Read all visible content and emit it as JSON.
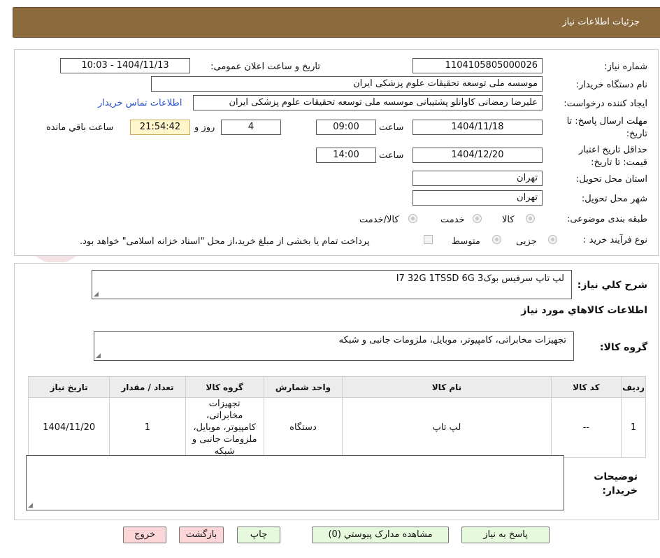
{
  "header": {
    "title": "جزئیات اطلاعات نیاز"
  },
  "form": {
    "need_number_label": "شماره نیاز:",
    "need_number": "1104105805000026",
    "announce_label": "تاریخ و ساعت اعلان عمومی:",
    "announce_value": "1404/11/13 - 10:03",
    "buyer_org_label": "نام دستگاه خریدار:",
    "buyer_org": "موسسه ملی توسعه تحقیقات علوم پزشکی ایران",
    "creator_label": "ایجاد کننده درخواست:",
    "creator": "علیرضا رمضانی کاوانلو پشتیبانی موسسه ملی توسعه تحقیقات علوم پزشکی ایران",
    "contact_link": "اطلاعات تماس خریدار",
    "deadline_label_1": "مهلت ارسال پاسخ: تا",
    "deadline_label_2": "تاریخ:",
    "deadline_date": "1404/11/18",
    "time_label": "ساعت",
    "deadline_time": "09:00",
    "days_value": "4",
    "days_label": "روز و",
    "remaining_time": "21:54:42",
    "remaining_label": "ساعت باقي مانده",
    "validity_label_1": "حداقل تاریخ اعتبار",
    "validity_label_2": "قیمت: تا تاریخ:",
    "validity_date": "1404/12/20",
    "validity_time_label": "ساعت",
    "validity_time": "14:00",
    "province_label": "استان محل تحویل:",
    "province": "تهران",
    "city_label": "شهر محل تحویل:",
    "city": "تهران",
    "category_label": "طبقه بندی موضوعی:",
    "category_options": [
      "کالا",
      "خدمت",
      "کالا/خدمت"
    ],
    "process_label": "نوع فرآیند خرید :",
    "process_options": [
      "جزیی",
      "متوسط"
    ],
    "payment_note": "پرداخت تمام یا بخشی از مبلغ خرید،از محل \"اسناد خزانه اسلامی\" خواهد بود."
  },
  "description": {
    "label": "شرح کلي نياز:",
    "text": "لپ تاپ سرفیس بوک3 I7 32G 1TSSD 6G"
  },
  "goods_info": {
    "title": "اطلاعات کالاهاي مورد نياز",
    "group_label": "گروه کالا:",
    "group_text": "تجهیزات مخابراتی، کامپیوتر، موبایل، ملزومات جانبی و شبکه"
  },
  "table": {
    "headers": [
      "رديف",
      "کد کالا",
      "نام کالا",
      "واحد شمارش",
      "گروه کالا",
      "تعداد / مقدار",
      "تاريخ نياز"
    ],
    "rows": [
      {
        "row": "1",
        "code": "--",
        "name": "لپ تاپ",
        "unit": "دستگاه",
        "group": "تجهیزات مخابراتی، کامپیوتر، موبایل، ملزومات جانبی و شبکه",
        "qty": "1",
        "date": "1404/11/20"
      }
    ]
  },
  "buyer_notes": {
    "label": "توضیحات خریدار:",
    "value": ""
  },
  "buttons": {
    "reply": "پاسخ به نیاز",
    "attachments": "مشاهده مدارک پيوستي (0)",
    "print": "چاپ",
    "back": "بازگشت",
    "exit": "خروج"
  },
  "colors": {
    "header_bg": "#8b6b3e",
    "highlight_bg": "#fff6cc",
    "link": "#2a55c8",
    "button_green": "#e6f9dc",
    "button_pink": "#fbd5d8"
  }
}
